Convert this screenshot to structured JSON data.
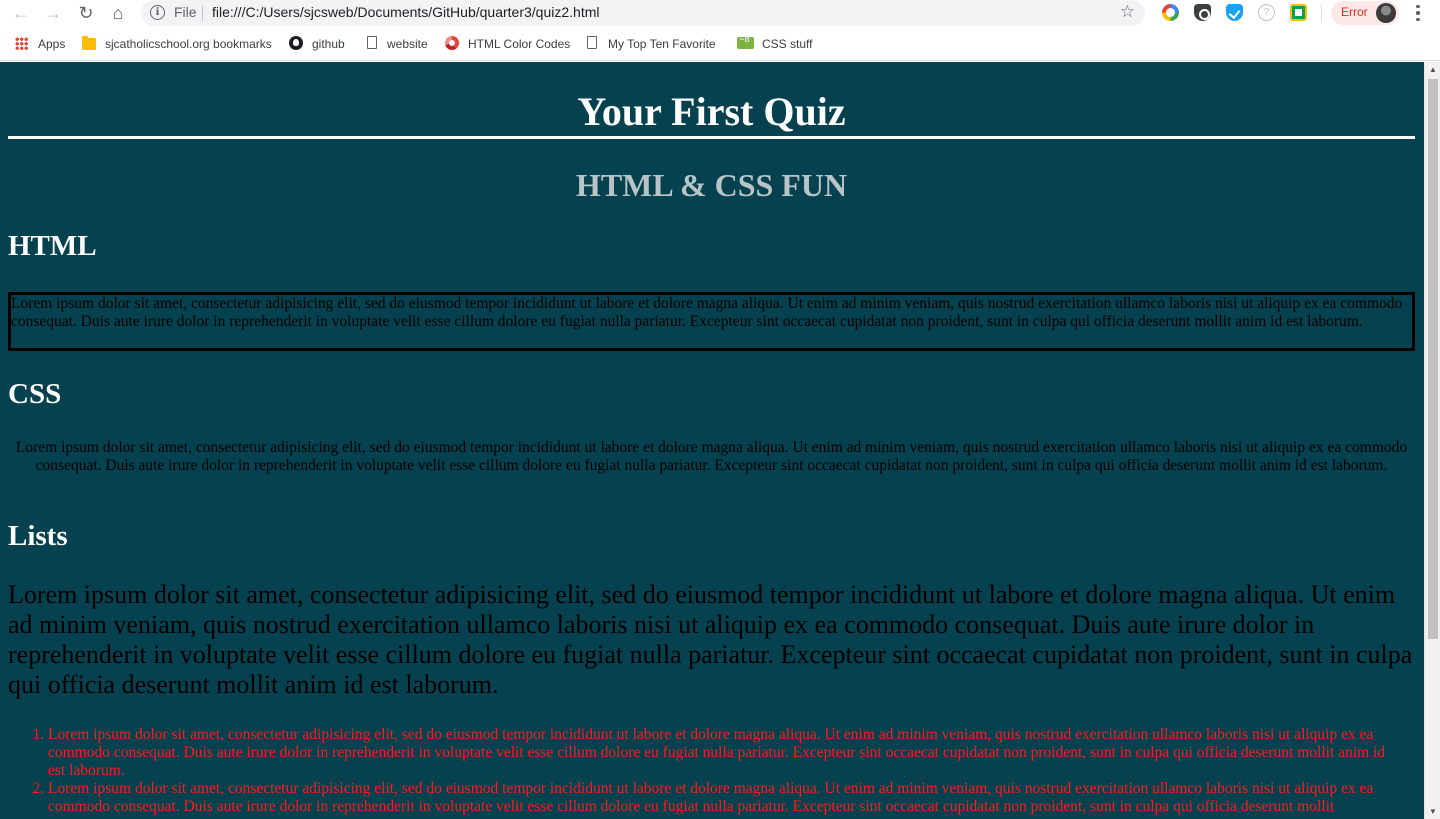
{
  "browser": {
    "omnibox": {
      "scheme_label": "File",
      "url": "file:///C:/Users/sjcsweb/Documents/GitHub/quarter3/quiz2.html"
    },
    "profile": {
      "status_label": "Error"
    },
    "bookmarks": [
      {
        "label": "Apps",
        "icon": "apps-grid-icon"
      },
      {
        "label": "sjcatholicschool.org bookmarks",
        "icon": "folder-icon"
      },
      {
        "label": "github",
        "icon": "github-icon"
      },
      {
        "label": "website",
        "icon": "page-icon"
      },
      {
        "label": "HTML Color Codes",
        "icon": "color-wheel-icon"
      },
      {
        "label": "My Top Ten Favorite I",
        "icon": "page-icon"
      },
      {
        "label": "CSS stuff",
        "icon": "css-icon"
      }
    ]
  },
  "page": {
    "background_color": "#05414e",
    "title": "Your First Quiz",
    "subtitle": "HTML & CSS FUN",
    "sections": {
      "html": {
        "heading": "HTML",
        "text": "Lorem ipsum dolor sit amet, consectetur adipisicing elit, sed do eiusmod tempor incididunt ut labore et dolore magna aliqua. Ut enim ad minim veniam, quis nostrud exercitation ullamco laboris nisi ut aliquip ex ea commodo consequat. Duis aute irure dolor in reprehenderit in voluptate velit esse cillum dolore eu fugiat nulla pariatur. Excepteur sint occaecat cupidatat non proident, sunt in culpa qui officia deserunt mollit anim id est laborum."
      },
      "css": {
        "heading": "CSS",
        "text": "Lorem ipsum dolor sit amet, consectetur adipisicing elit, sed do eiusmod tempor incididunt ut labore et dolore magna aliqua. Ut enim ad minim veniam, quis nostrud exercitation ullamco laboris nisi ut aliquip ex ea commodo consequat. Duis aute irure dolor in reprehenderit in voluptate velit esse cillum dolore eu fugiat nulla pariatur. Excepteur sint occaecat cupidatat non proident, sunt in culpa qui officia deserunt mollit anim id est laborum."
      },
      "lists": {
        "heading": "Lists",
        "text": "Lorem ipsum dolor sit amet, consectetur adipisicing elit, sed do eiusmod tempor incididunt ut labore et dolore magna aliqua. Ut enim ad minim veniam, quis nostrud exercitation ullamco laboris nisi ut aliquip ex ea commodo consequat. Duis aute irure dolor in reprehenderit in voluptate velit esse cillum dolore eu fugiat nulla pariatur. Excepteur sint occaecat cupidatat non proident, sunt in culpa qui officia deserunt mollit anim id est laborum.",
        "list_color": "#ff1b1b",
        "items": [
          "Lorem ipsum dolor sit amet, consectetur adipisicing elit, sed do eiusmod tempor incididunt ut labore et dolore magna aliqua. Ut enim ad minim veniam, quis nostrud exercitation ullamco laboris nisi ut aliquip ex ea commodo consequat. Duis aute irure dolor in reprehenderit in voluptate velit esse cillum dolore eu fugiat nulla pariatur. Excepteur sint occaecat cupidatat non proident, sunt in culpa qui officia deserunt mollit anim id est laborum.",
          "Lorem ipsum dolor sit amet, consectetur adipisicing elit, sed do eiusmod tempor incididunt ut labore et dolore magna aliqua. Ut enim ad minim veniam, quis nostrud exercitation ullamco laboris nisi ut aliquip ex ea commodo consequat. Duis aute irure dolor in reprehenderit in voluptate velit esse cillum dolore eu fugiat nulla pariatur. Excepteur sint occaecat cupidatat non proident, sunt in culpa qui officia deserunt mollit"
        ]
      }
    }
  }
}
